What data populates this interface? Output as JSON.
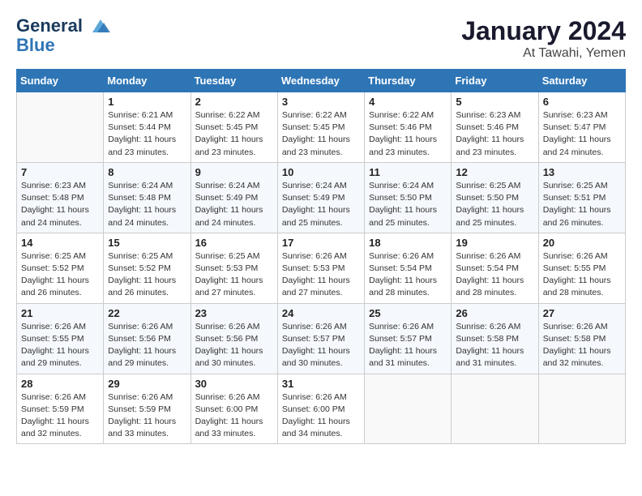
{
  "header": {
    "logo_line1": "General",
    "logo_line2": "Blue",
    "main_title": "January 2024",
    "sub_title": "At Tawahi, Yemen"
  },
  "calendar": {
    "days_of_week": [
      "Sunday",
      "Monday",
      "Tuesday",
      "Wednesday",
      "Thursday",
      "Friday",
      "Saturday"
    ],
    "weeks": [
      [
        {
          "day": "",
          "info": ""
        },
        {
          "day": "1",
          "info": "Sunrise: 6:21 AM\nSunset: 5:44 PM\nDaylight: 11 hours\nand 23 minutes."
        },
        {
          "day": "2",
          "info": "Sunrise: 6:22 AM\nSunset: 5:45 PM\nDaylight: 11 hours\nand 23 minutes."
        },
        {
          "day": "3",
          "info": "Sunrise: 6:22 AM\nSunset: 5:45 PM\nDaylight: 11 hours\nand 23 minutes."
        },
        {
          "day": "4",
          "info": "Sunrise: 6:22 AM\nSunset: 5:46 PM\nDaylight: 11 hours\nand 23 minutes."
        },
        {
          "day": "5",
          "info": "Sunrise: 6:23 AM\nSunset: 5:46 PM\nDaylight: 11 hours\nand 23 minutes."
        },
        {
          "day": "6",
          "info": "Sunrise: 6:23 AM\nSunset: 5:47 PM\nDaylight: 11 hours\nand 24 minutes."
        }
      ],
      [
        {
          "day": "7",
          "info": "Sunrise: 6:23 AM\nSunset: 5:48 PM\nDaylight: 11 hours\nand 24 minutes."
        },
        {
          "day": "8",
          "info": "Sunrise: 6:24 AM\nSunset: 5:48 PM\nDaylight: 11 hours\nand 24 minutes."
        },
        {
          "day": "9",
          "info": "Sunrise: 6:24 AM\nSunset: 5:49 PM\nDaylight: 11 hours\nand 24 minutes."
        },
        {
          "day": "10",
          "info": "Sunrise: 6:24 AM\nSunset: 5:49 PM\nDaylight: 11 hours\nand 25 minutes."
        },
        {
          "day": "11",
          "info": "Sunrise: 6:24 AM\nSunset: 5:50 PM\nDaylight: 11 hours\nand 25 minutes."
        },
        {
          "day": "12",
          "info": "Sunrise: 6:25 AM\nSunset: 5:50 PM\nDaylight: 11 hours\nand 25 minutes."
        },
        {
          "day": "13",
          "info": "Sunrise: 6:25 AM\nSunset: 5:51 PM\nDaylight: 11 hours\nand 26 minutes."
        }
      ],
      [
        {
          "day": "14",
          "info": "Sunrise: 6:25 AM\nSunset: 5:52 PM\nDaylight: 11 hours\nand 26 minutes."
        },
        {
          "day": "15",
          "info": "Sunrise: 6:25 AM\nSunset: 5:52 PM\nDaylight: 11 hours\nand 26 minutes."
        },
        {
          "day": "16",
          "info": "Sunrise: 6:25 AM\nSunset: 5:53 PM\nDaylight: 11 hours\nand 27 minutes."
        },
        {
          "day": "17",
          "info": "Sunrise: 6:26 AM\nSunset: 5:53 PM\nDaylight: 11 hours\nand 27 minutes."
        },
        {
          "day": "18",
          "info": "Sunrise: 6:26 AM\nSunset: 5:54 PM\nDaylight: 11 hours\nand 28 minutes."
        },
        {
          "day": "19",
          "info": "Sunrise: 6:26 AM\nSunset: 5:54 PM\nDaylight: 11 hours\nand 28 minutes."
        },
        {
          "day": "20",
          "info": "Sunrise: 6:26 AM\nSunset: 5:55 PM\nDaylight: 11 hours\nand 28 minutes."
        }
      ],
      [
        {
          "day": "21",
          "info": "Sunrise: 6:26 AM\nSunset: 5:55 PM\nDaylight: 11 hours\nand 29 minutes."
        },
        {
          "day": "22",
          "info": "Sunrise: 6:26 AM\nSunset: 5:56 PM\nDaylight: 11 hours\nand 29 minutes."
        },
        {
          "day": "23",
          "info": "Sunrise: 6:26 AM\nSunset: 5:56 PM\nDaylight: 11 hours\nand 30 minutes."
        },
        {
          "day": "24",
          "info": "Sunrise: 6:26 AM\nSunset: 5:57 PM\nDaylight: 11 hours\nand 30 minutes."
        },
        {
          "day": "25",
          "info": "Sunrise: 6:26 AM\nSunset: 5:57 PM\nDaylight: 11 hours\nand 31 minutes."
        },
        {
          "day": "26",
          "info": "Sunrise: 6:26 AM\nSunset: 5:58 PM\nDaylight: 11 hours\nand 31 minutes."
        },
        {
          "day": "27",
          "info": "Sunrise: 6:26 AM\nSunset: 5:58 PM\nDaylight: 11 hours\nand 32 minutes."
        }
      ],
      [
        {
          "day": "28",
          "info": "Sunrise: 6:26 AM\nSunset: 5:59 PM\nDaylight: 11 hours\nand 32 minutes."
        },
        {
          "day": "29",
          "info": "Sunrise: 6:26 AM\nSunset: 5:59 PM\nDaylight: 11 hours\nand 33 minutes."
        },
        {
          "day": "30",
          "info": "Sunrise: 6:26 AM\nSunset: 6:00 PM\nDaylight: 11 hours\nand 33 minutes."
        },
        {
          "day": "31",
          "info": "Sunrise: 6:26 AM\nSunset: 6:00 PM\nDaylight: 11 hours\nand 34 minutes."
        },
        {
          "day": "",
          "info": ""
        },
        {
          "day": "",
          "info": ""
        },
        {
          "day": "",
          "info": ""
        }
      ]
    ]
  }
}
